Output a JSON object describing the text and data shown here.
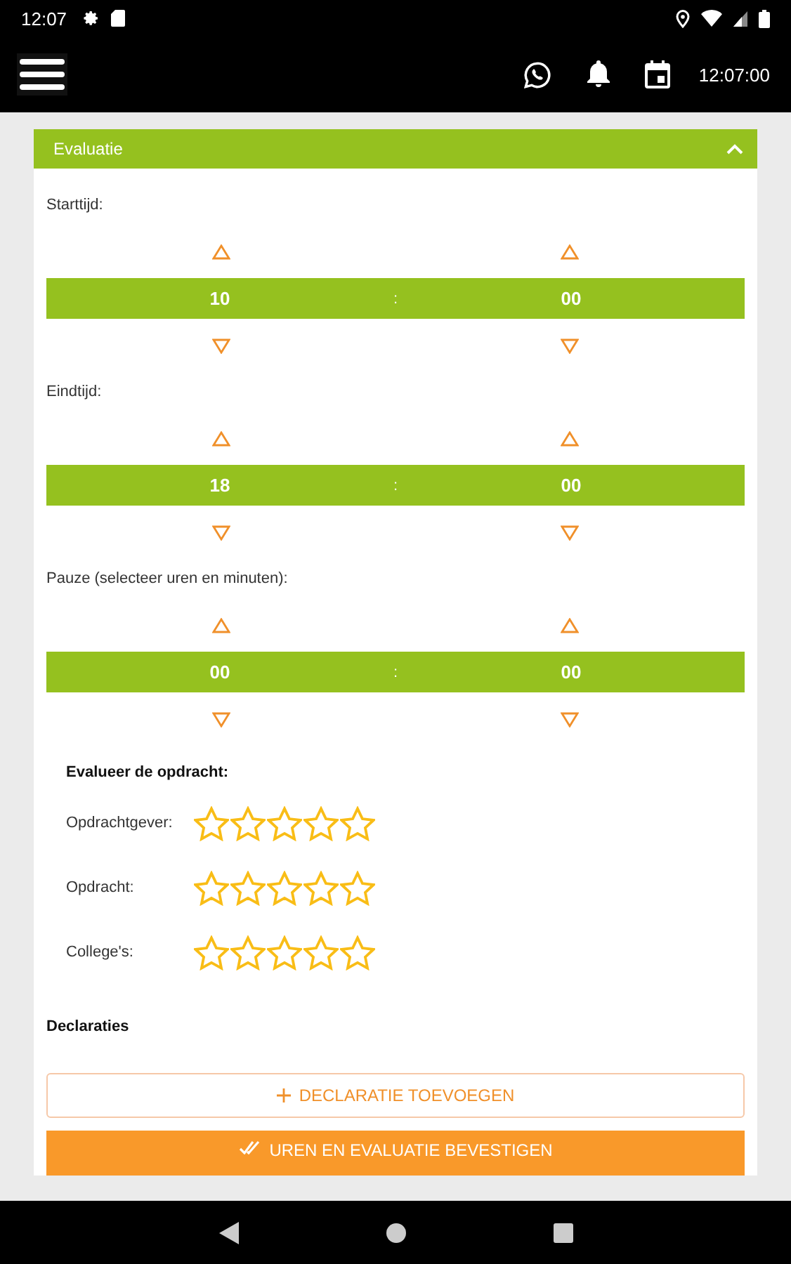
{
  "status_bar": {
    "time": "12:07"
  },
  "app_bar": {
    "clock": "12:07:00"
  },
  "panel": {
    "title": "Evaluatie",
    "expanded": true
  },
  "time_pickers": [
    {
      "label": "Starttijd:",
      "hours": "10",
      "separator": ":",
      "minutes": "00"
    },
    {
      "label": "Eindtijd:",
      "hours": "18",
      "separator": ":",
      "minutes": "00"
    },
    {
      "label": "Pauze (selecteer uren en minuten):",
      "hours": "00",
      "separator": ":",
      "minutes": "00"
    }
  ],
  "evaluation": {
    "title": "Evalueer de opdracht:",
    "ratings": [
      {
        "label": "Opdrachtgever:",
        "stars": 0
      },
      {
        "label": "Opdracht:",
        "stars": 0
      },
      {
        "label": "College's:",
        "stars": 0
      }
    ]
  },
  "declarations": {
    "title": "Declaraties",
    "add_button": "DECLARATIE TOEVOEGEN"
  },
  "confirm_button": "UREN EN EVALUATIE BEVESTIGEN"
}
